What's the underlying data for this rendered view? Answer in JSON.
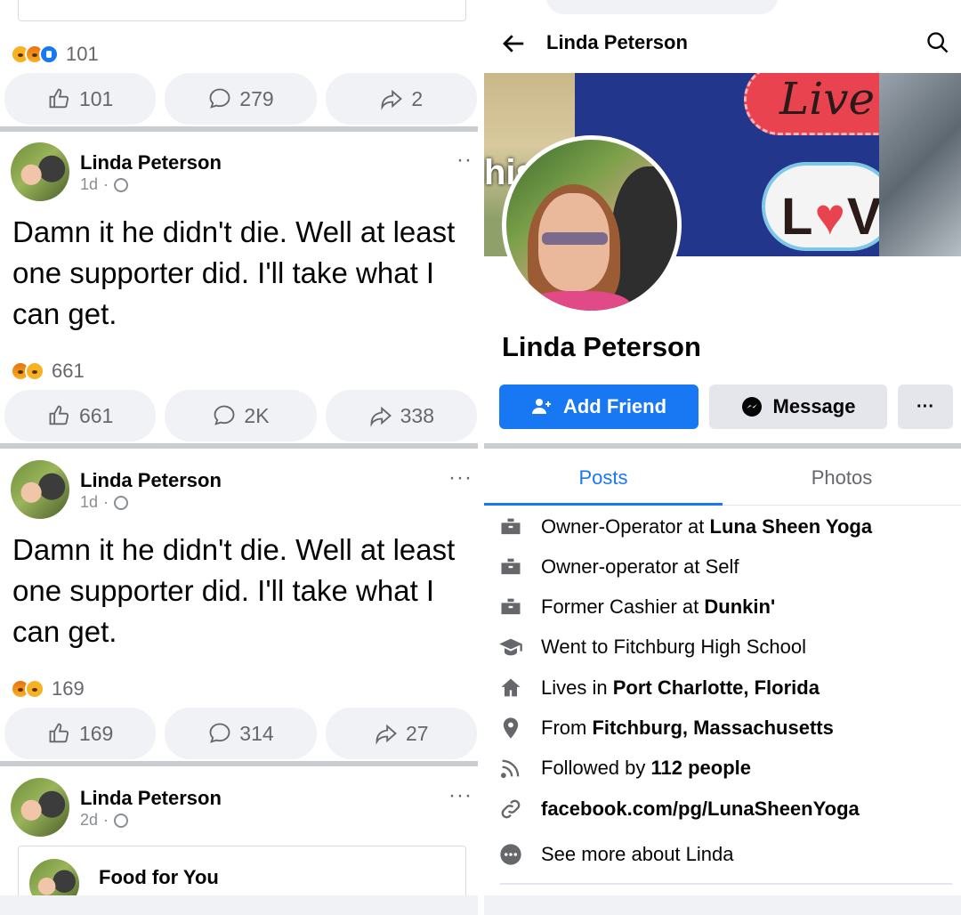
{
  "feed": {
    "top_post": {
      "reaction_count": "101",
      "like_count": "101",
      "comment_count": "279",
      "share_count": "2"
    },
    "posts": [
      {
        "author": "Linda Peterson",
        "time": "1d",
        "text": "Damn it he didn't die. Well at least one supporter did.  I'll take what I can get.",
        "menu": "··",
        "reaction_count": "661",
        "like_count": "661",
        "comment_count": "2K",
        "share_count": "338"
      },
      {
        "author": "Linda Peterson",
        "time": "1d",
        "text": "Damn it he didn't die. Well at least one supporter did.  I'll take what I can get.",
        "menu": "···",
        "reaction_count": "169",
        "like_count": "169",
        "comment_count": "314",
        "share_count": "27"
      },
      {
        "author": "Linda Peterson",
        "time": "2d",
        "menu": "···",
        "shared_card_title": "Food for You"
      }
    ]
  },
  "profile": {
    "header_title": "Linda Peterson",
    "overlay_text": "his shit",
    "cover_text_1": "Live",
    "cover_text_2a": "L",
    "cover_text_2b": "♥",
    "cover_text_2c": "VE",
    "name": "Linda Peterson",
    "buttons": {
      "add_friend": "Add Friend",
      "message": "Message",
      "more": "···"
    },
    "tabs": [
      "Posts",
      "Photos"
    ],
    "details": [
      {
        "icon": "briefcase-icon",
        "prefix": "Owner-Operator at ",
        "bold": "Luna Sheen Yoga"
      },
      {
        "icon": "briefcase-icon",
        "prefix": "Owner-operator at Self",
        "bold": ""
      },
      {
        "icon": "briefcase-icon",
        "prefix": "Former Cashier at ",
        "bold": "Dunkin'"
      },
      {
        "icon": "graduation-cap-icon",
        "prefix": "Went to Fitchburg High School",
        "bold": ""
      },
      {
        "icon": "home-icon",
        "prefix": "Lives in ",
        "bold": "Port Charlotte, Florida"
      },
      {
        "icon": "location-pin-icon",
        "prefix": "From ",
        "bold": "Fitchburg, Massachusetts"
      },
      {
        "icon": "rss-icon",
        "prefix": "Followed by ",
        "bold": "112 people"
      },
      {
        "icon": "link-icon",
        "prefix": "",
        "bold": "facebook.com/pg/LunaSheenYoga"
      },
      {
        "icon": "more-circle-icon",
        "prefix": "See more about Linda",
        "bold": ""
      }
    ]
  },
  "colors": {
    "brand_blue": "#1877f2",
    "muted_text": "#65676b",
    "divider_gray": "#c9ccd1",
    "button_gray": "#e4e6eb"
  }
}
